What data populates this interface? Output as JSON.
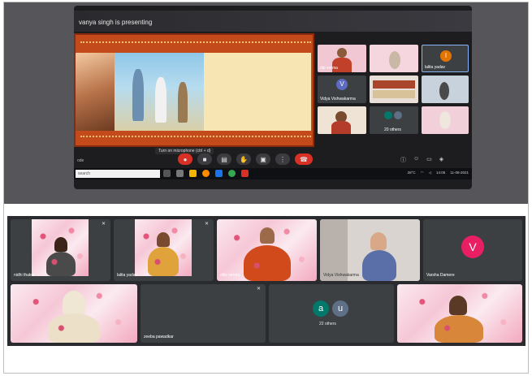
{
  "presenter_banner": "vanya singh is presenting",
  "upper": {
    "participants": [
      {
        "name": "dip verma"
      },
      {
        "name": ""
      },
      {
        "name": "lalita yadav",
        "initial": "l"
      },
      {
        "name": "Vidya Vishwakarma",
        "initial": "V"
      },
      {
        "name": ""
      },
      {
        "name": ""
      },
      {
        "name": ""
      },
      {
        "name": "20 others"
      },
      {
        "name": ""
      }
    ],
    "tooltip": "Turn on microphone (ctrl + d)",
    "exit_label": "ode",
    "search_placeholder": "search",
    "tray_text": "28°C",
    "clock_time": "14:05",
    "clock_date": "11-08-2021"
  },
  "grid": {
    "tiles": [
      {
        "name": "nidhi thakur"
      },
      {
        "name": "lalita yadav"
      },
      {
        "name": "dilip verma"
      },
      {
        "name": "Vidya Vishwakarma"
      },
      {
        "name": "Varsha Damere",
        "initial": "V",
        "color": "#e91e63"
      },
      {
        "name": ""
      },
      {
        "name": "zeeba pawadkar"
      },
      {
        "name": "22 others",
        "initials": [
          "a",
          "u"
        ],
        "colors": [
          "#00796b",
          "#5f6f86"
        ]
      },
      {
        "name": ""
      }
    ]
  },
  "colors": {
    "end_call": "#d93025",
    "tile_bg": "#3c4043",
    "grid_bg": "#2a2b2f"
  }
}
